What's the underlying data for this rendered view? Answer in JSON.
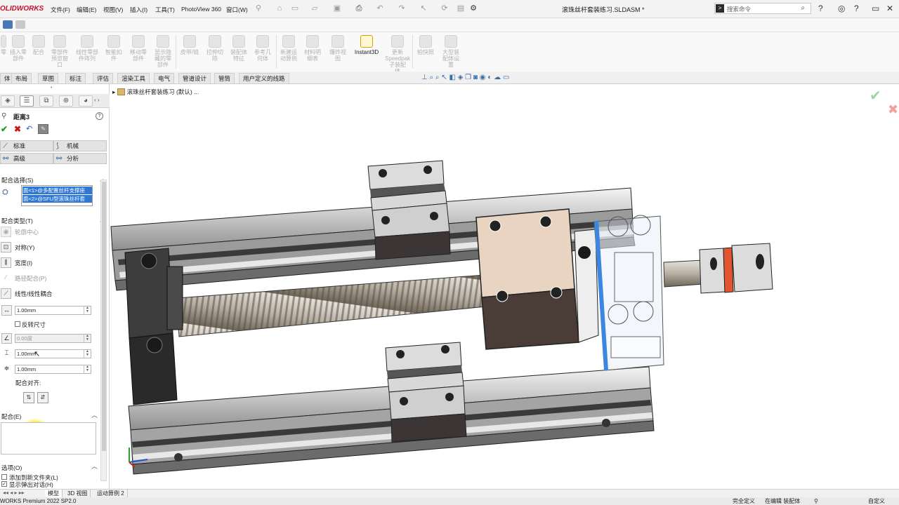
{
  "app": {
    "logo": "OLIDWORKS",
    "menu": [
      "文件(F)",
      "编辑(E)",
      "视图(V)",
      "插入(I)",
      "工具(T)",
      "PhotoView 360",
      "窗口(W)"
    ],
    "doc_title": "滚珠丝杆套装练习.SLDASM *",
    "search_placeholder": "搜索命令"
  },
  "command_manager": {
    "items": [
      {
        "label": "零",
        "icon": "component-icon"
      },
      {
        "label": "插入零\n部件",
        "icon": "insert-component-icon"
      },
      {
        "label": "配合",
        "icon": "mate-icon"
      },
      {
        "label": "零部件\n预览窗\n口",
        "icon": "preview-window-icon"
      },
      {
        "label": "线性零部\n件阵列",
        "icon": "linear-pattern-icon"
      },
      {
        "label": "智能扣\n件",
        "icon": "smart-fastener-icon"
      },
      {
        "label": "移动零\n部件",
        "icon": "move-component-icon"
      },
      {
        "label": "显示隐\n藏的零\n部件",
        "icon": "show-hidden-icon"
      },
      {
        "label": "皮带/链",
        "icon": "belt-chain-icon"
      },
      {
        "label": "拉伸切\n除",
        "icon": "extrude-cut-icon"
      },
      {
        "label": "装配体\n特征",
        "icon": "assembly-feature-icon"
      },
      {
        "label": "参考几\n何体",
        "icon": "reference-geometry-icon"
      },
      {
        "label": "新建运\n动算例",
        "icon": "motion-study-icon"
      },
      {
        "label": "材料明\n细表",
        "icon": "bom-icon"
      },
      {
        "label": "爆炸视\n图",
        "icon": "exploded-view-icon"
      },
      {
        "label": "Instant3D",
        "icon": "instant3d-icon"
      },
      {
        "label": "更新\nSpeedpak\n子装配\n体",
        "icon": "speedpak-icon"
      },
      {
        "label": "拍快照",
        "icon": "snapshot-icon"
      },
      {
        "label": "大型装\n配体设\n置",
        "icon": "large-assembly-icon"
      }
    ]
  },
  "tabs": [
    "体",
    "布局",
    "草图",
    "标注",
    "评估",
    "渲染工具",
    "电气",
    "管道设计",
    "管筒",
    "用户定义的线路"
  ],
  "property_manager": {
    "title": "距离3",
    "help": "?",
    "modes": [
      {
        "label": "标准",
        "icon": "standard-mode-icon"
      },
      {
        "label": "机械",
        "icon": "mechanical-mode-icon"
      },
      {
        "label": "高级",
        "icon": "advanced-mode-icon"
      },
      {
        "label": "分析",
        "icon": "analysis-mode-icon"
      }
    ],
    "mate_selections_header": "配合选择(S)",
    "selections": [
      "面<1>@多配置丝杆支撑座",
      "面<2>@SFU型滚珠丝杆套"
    ],
    "mate_types_header": "配合类型(T)",
    "mate_types": [
      {
        "label": "轮廓中心",
        "dim": true
      },
      {
        "label": "对称(Y)",
        "dim": false
      },
      {
        "label": "宽度(I)",
        "dim": false
      },
      {
        "label": "路径配合(P)",
        "dim": true
      },
      {
        "label": "线性/线性耦合",
        "dim": false
      }
    ],
    "distance_value": "1.00mm",
    "flip_label": "反转尺寸",
    "angle_value": "0.00度",
    "max_value": "1.00mm",
    "min_value": "1.00mm",
    "align_label": "配合对齐:",
    "mates_header": "配合(E)",
    "options_header": "选项(O)",
    "option_add_folder": "添加到新文件夹(L)",
    "option_show_popup": "显示弹出对话(H)"
  },
  "graphics": {
    "tree_root": "滚珠丝杆套装练习 (默认) ..."
  },
  "bottom_tabs": [
    "模型",
    "3D 视图",
    "运动算例 2"
  ],
  "status": {
    "left": "WORKS Premium 2022 SP2.0",
    "right": [
      "完全定义",
      "在编辑 装配体",
      "自定义"
    ]
  },
  "colors": {
    "selection_blue": "#2f78d4",
    "ok_green": "#1aa01a",
    "cancel_red": "#c81818",
    "brand_red": "#c8102e",
    "cursor_highlight": "#ffe600"
  }
}
